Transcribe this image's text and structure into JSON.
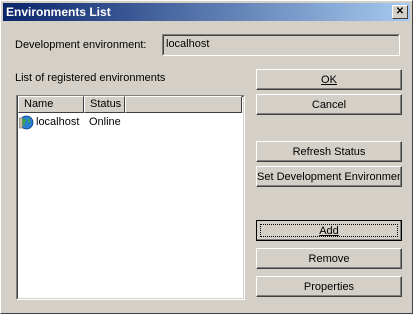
{
  "window": {
    "title": "Environments List",
    "close_glyph": "✕"
  },
  "dev_env": {
    "label": "Development environment:",
    "value": "localhost"
  },
  "list": {
    "label": "List of registered environments",
    "columns": [
      "Name",
      "Status"
    ],
    "rows": [
      {
        "icon": "server-globe-icon",
        "name": "localhost",
        "status": "Online"
      }
    ]
  },
  "buttons": {
    "ok": "OK",
    "cancel": "Cancel",
    "refresh": "Refresh Status",
    "set_dev": "Set Development Environment",
    "add": "Add",
    "remove": "Remove",
    "properties": "Properties"
  }
}
